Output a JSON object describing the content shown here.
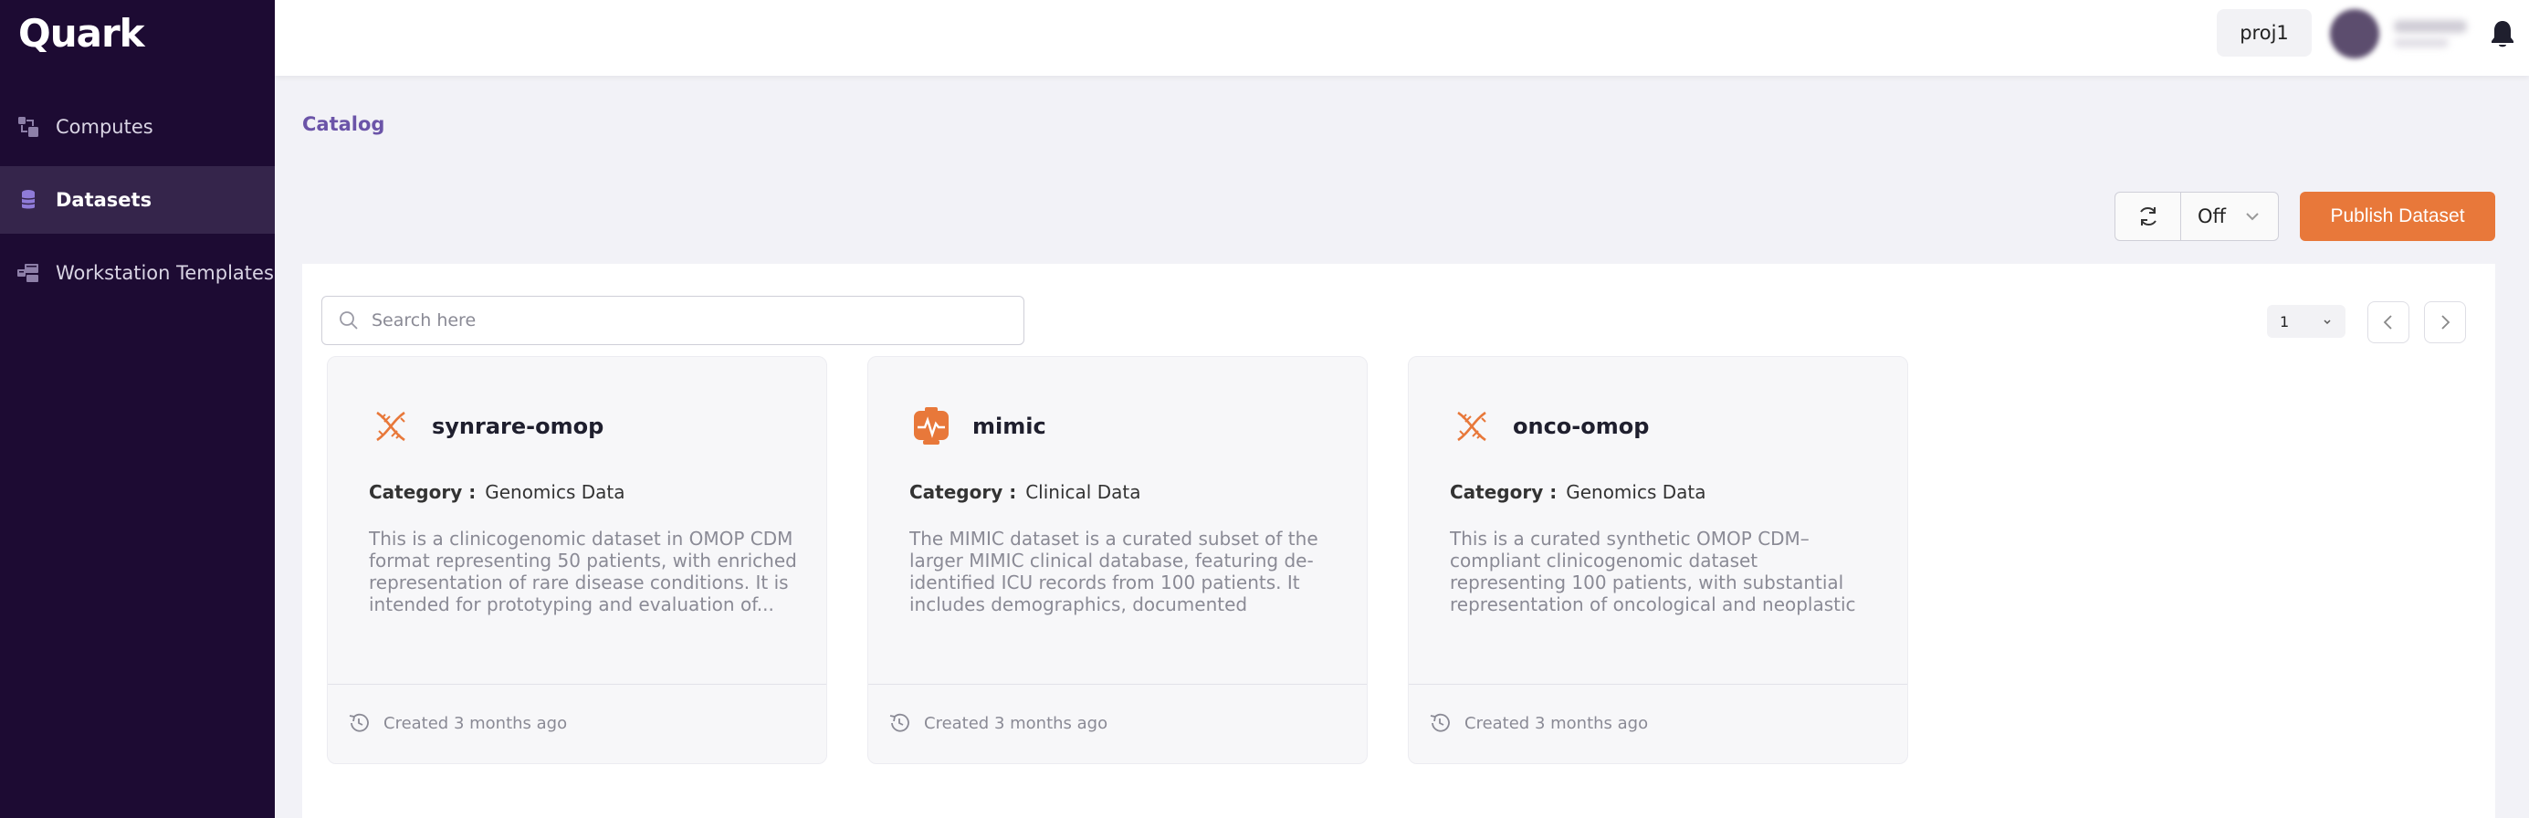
{
  "app": {
    "logo": "Quark"
  },
  "sidebar": {
    "items": [
      {
        "label": "Computes",
        "icon": "computes-icon",
        "active": false
      },
      {
        "label": "Datasets",
        "icon": "database-icon",
        "active": true
      },
      {
        "label": "Workstation Templates",
        "icon": "workstation-templates-icon",
        "active": false
      }
    ]
  },
  "topbar": {
    "project": "proj1",
    "notifications_icon": "bell-icon"
  },
  "breadcrumb": "Catalog",
  "toolbar": {
    "refresh_value": "Off",
    "publish_label": "Publish Dataset"
  },
  "search": {
    "placeholder": "Search here",
    "value": ""
  },
  "pagination": {
    "page": "1"
  },
  "datasets": [
    {
      "name": "synrare-omop",
      "icon": "dna-icon",
      "category_label": "Category :",
      "category": "Genomics Data",
      "description": "This is a clinicogenomic dataset in OMOP CDM format representing 50 patients, with enriched representation of rare disease conditions. It is intended for prototyping and evaluation of...",
      "created": "Created 3 months ago"
    },
    {
      "name": "mimic",
      "icon": "clinical-monitor-icon",
      "category_label": "Category :",
      "category": "Clinical Data",
      "description": "The MIMIC dataset is a curated subset of the larger MIMIC clinical database, featuring de-identified ICU records from 100 patients. It includes demographics, documented medical...",
      "created": "Created 3 months ago"
    },
    {
      "name": "onco-omop",
      "icon": "dna-icon",
      "category_label": "Category :",
      "category": "Genomics Data",
      "description": "This is a curated synthetic OMOP CDM–compliant clinicogenomic dataset representing 100 patients, with substantial representation of oncological and neoplastic conditions. It supports testing,...",
      "created": "Created 3 months ago"
    }
  ],
  "colors": {
    "sidebar": "#1d0b33",
    "accent": "#e8783a",
    "breadcrumb": "#6b54a8"
  }
}
